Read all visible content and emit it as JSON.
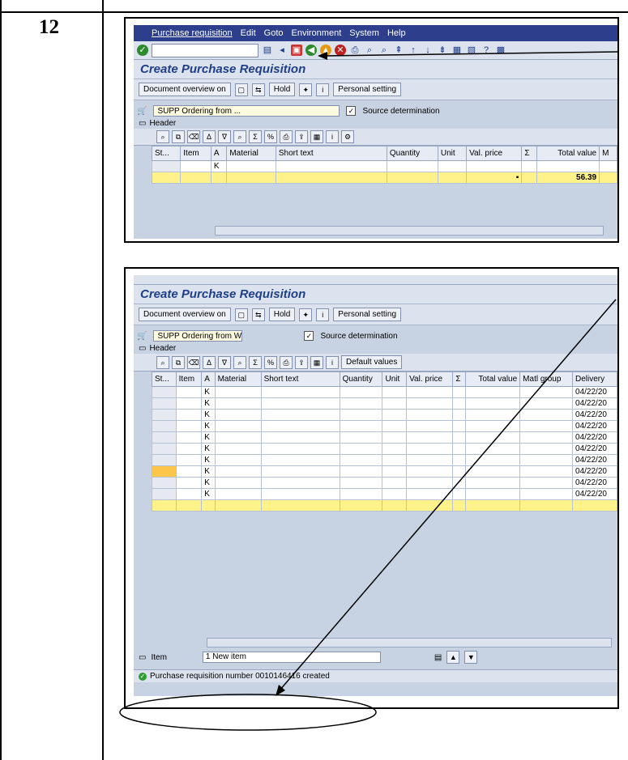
{
  "step": {
    "number": "12"
  },
  "screen1": {
    "menu": [
      "Purchase requisition",
      "Edit",
      "Goto",
      "Environment",
      "System",
      "Help"
    ],
    "title": "Create Purchase Requisition",
    "app_buttons": {
      "doc_overview": "Document overview on",
      "hold": "Hold",
      "personal": "Personal setting"
    },
    "doc_type": "SUPP Ordering from ...",
    "source_det": "Source determination",
    "header_label": "Header",
    "columns": [
      "St...",
      "Item",
      "A",
      "Material",
      "Short text",
      "Quantity",
      "Unit",
      "Val. price",
      "Σ",
      "Total value",
      "M"
    ],
    "rows": [
      [
        "",
        "",
        "K",
        "",
        "",
        "",
        "",
        "",
        "",
        "",
        ""
      ]
    ],
    "total_marker": "▪",
    "total_value": "56.39"
  },
  "screen2": {
    "title": "Create Purchase Requisition",
    "app_buttons": {
      "doc_overview": "Document overview on",
      "hold": "Hold",
      "personal": "Personal setting",
      "default_values": "Default values"
    },
    "doc_type": "SUPP Ordering from W",
    "source_det": "Source determination",
    "header_label": "Header",
    "columns": [
      "St...",
      "Item",
      "A",
      "Material",
      "Short text",
      "Quantity",
      "Unit",
      "Val. price",
      "Σ",
      "Total value",
      "Matl group",
      "Delivery"
    ],
    "rows": [
      [
        "",
        "",
        "K",
        "",
        "",
        "",
        "",
        "",
        "",
        "",
        "",
        "04/22/20"
      ],
      [
        "",
        "",
        "K",
        "",
        "",
        "",
        "",
        "",
        "",
        "",
        "",
        "04/22/20"
      ],
      [
        "",
        "",
        "K",
        "",
        "",
        "",
        "",
        "",
        "",
        "",
        "",
        "04/22/20"
      ],
      [
        "",
        "",
        "K",
        "",
        "",
        "",
        "",
        "",
        "",
        "",
        "",
        "04/22/20"
      ],
      [
        "",
        "",
        "K",
        "",
        "",
        "",
        "",
        "",
        "",
        "",
        "",
        "04/22/20"
      ],
      [
        "",
        "",
        "K",
        "",
        "",
        "",
        "",
        "",
        "",
        "",
        "",
        "04/22/20"
      ],
      [
        "",
        "",
        "K",
        "",
        "",
        "",
        "",
        "",
        "",
        "",
        "",
        "04/22/20"
      ],
      [
        "",
        "",
        "K",
        "",
        "",
        "",
        "",
        "",
        "",
        "",
        "",
        "04/22/20"
      ],
      [
        "",
        "",
        "K",
        "",
        "",
        "",
        "",
        "",
        "",
        "",
        "",
        "04/22/20"
      ],
      [
        "",
        "",
        "K",
        "",
        "",
        "",
        "",
        "",
        "",
        "",
        "",
        "04/22/20"
      ]
    ],
    "item_label": "Item",
    "item_value": "1 New item",
    "status_message": "Purchase requisition number 0010146416 created"
  }
}
